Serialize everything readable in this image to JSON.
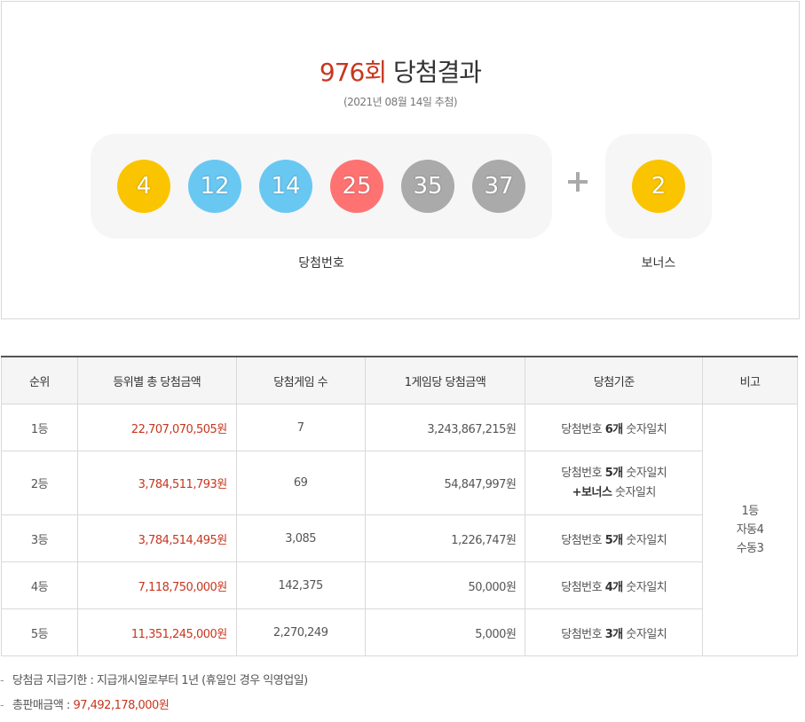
{
  "header": {
    "round": "976회",
    "title_suffix": "당첨결과",
    "draw_date": "(2021년 08월 14일 추첨)"
  },
  "numbers": {
    "winning": [
      "4",
      "12",
      "14",
      "25",
      "35",
      "37"
    ],
    "bonus": "2",
    "winning_label": "당첨번호",
    "bonus_label": "보너스"
  },
  "table": {
    "headers": [
      "순위",
      "등위별 총 당첨금액",
      "당첨게임 수",
      "1게임당 당첨금액",
      "당첨기준",
      "비고"
    ],
    "rows": [
      {
        "rank": "1등",
        "total": "22,707,070,505원",
        "games": "7",
        "per_game": "3,243,867,215원",
        "crit_pre": "당첨번호 ",
        "crit_bold": "6개",
        "crit_post": " 숫자일치",
        "crit2_bold": "",
        "crit2_post": ""
      },
      {
        "rank": "2등",
        "total": "3,784,511,793원",
        "games": "69",
        "per_game": "54,847,997원",
        "crit_pre": "당첨번호 ",
        "crit_bold": "5개",
        "crit_post": " 숫자일치",
        "crit2_bold": "+보너스",
        "crit2_post": " 숫자일치"
      },
      {
        "rank": "3등",
        "total": "3,784,514,495원",
        "games": "3,085",
        "per_game": "1,226,747원",
        "crit_pre": "당첨번호 ",
        "crit_bold": "5개",
        "crit_post": " 숫자일치",
        "crit2_bold": "",
        "crit2_post": ""
      },
      {
        "rank": "4등",
        "total": "7,118,750,000원",
        "games": "142,375",
        "per_game": "50,000원",
        "crit_pre": "당첨번호 ",
        "crit_bold": "4개",
        "crit_post": " 숫자일치",
        "crit2_bold": "",
        "crit2_post": ""
      },
      {
        "rank": "5등",
        "total": "11,351,245,000원",
        "games": "2,270,249",
        "per_game": "5,000원",
        "crit_pre": "당첨번호 ",
        "crit_bold": "3개",
        "crit_post": " 숫자일치",
        "crit2_bold": "",
        "crit2_post": ""
      }
    ],
    "note": [
      "1등",
      "자동4",
      "수동3"
    ]
  },
  "notes": {
    "deadline": "당첨금 지급기한 : 지급개시일로부터 1년 (휴일인 경우 익영업일)",
    "sales_label": "총판매금액 : ",
    "sales_value": "97,492,178,000원"
  },
  "colors": {
    "accent": "#c8361e",
    "ball_yellow": "#fbc400",
    "ball_blue": "#69c8f2",
    "ball_red": "#ff7272",
    "ball_gray": "#aaaaaa"
  }
}
